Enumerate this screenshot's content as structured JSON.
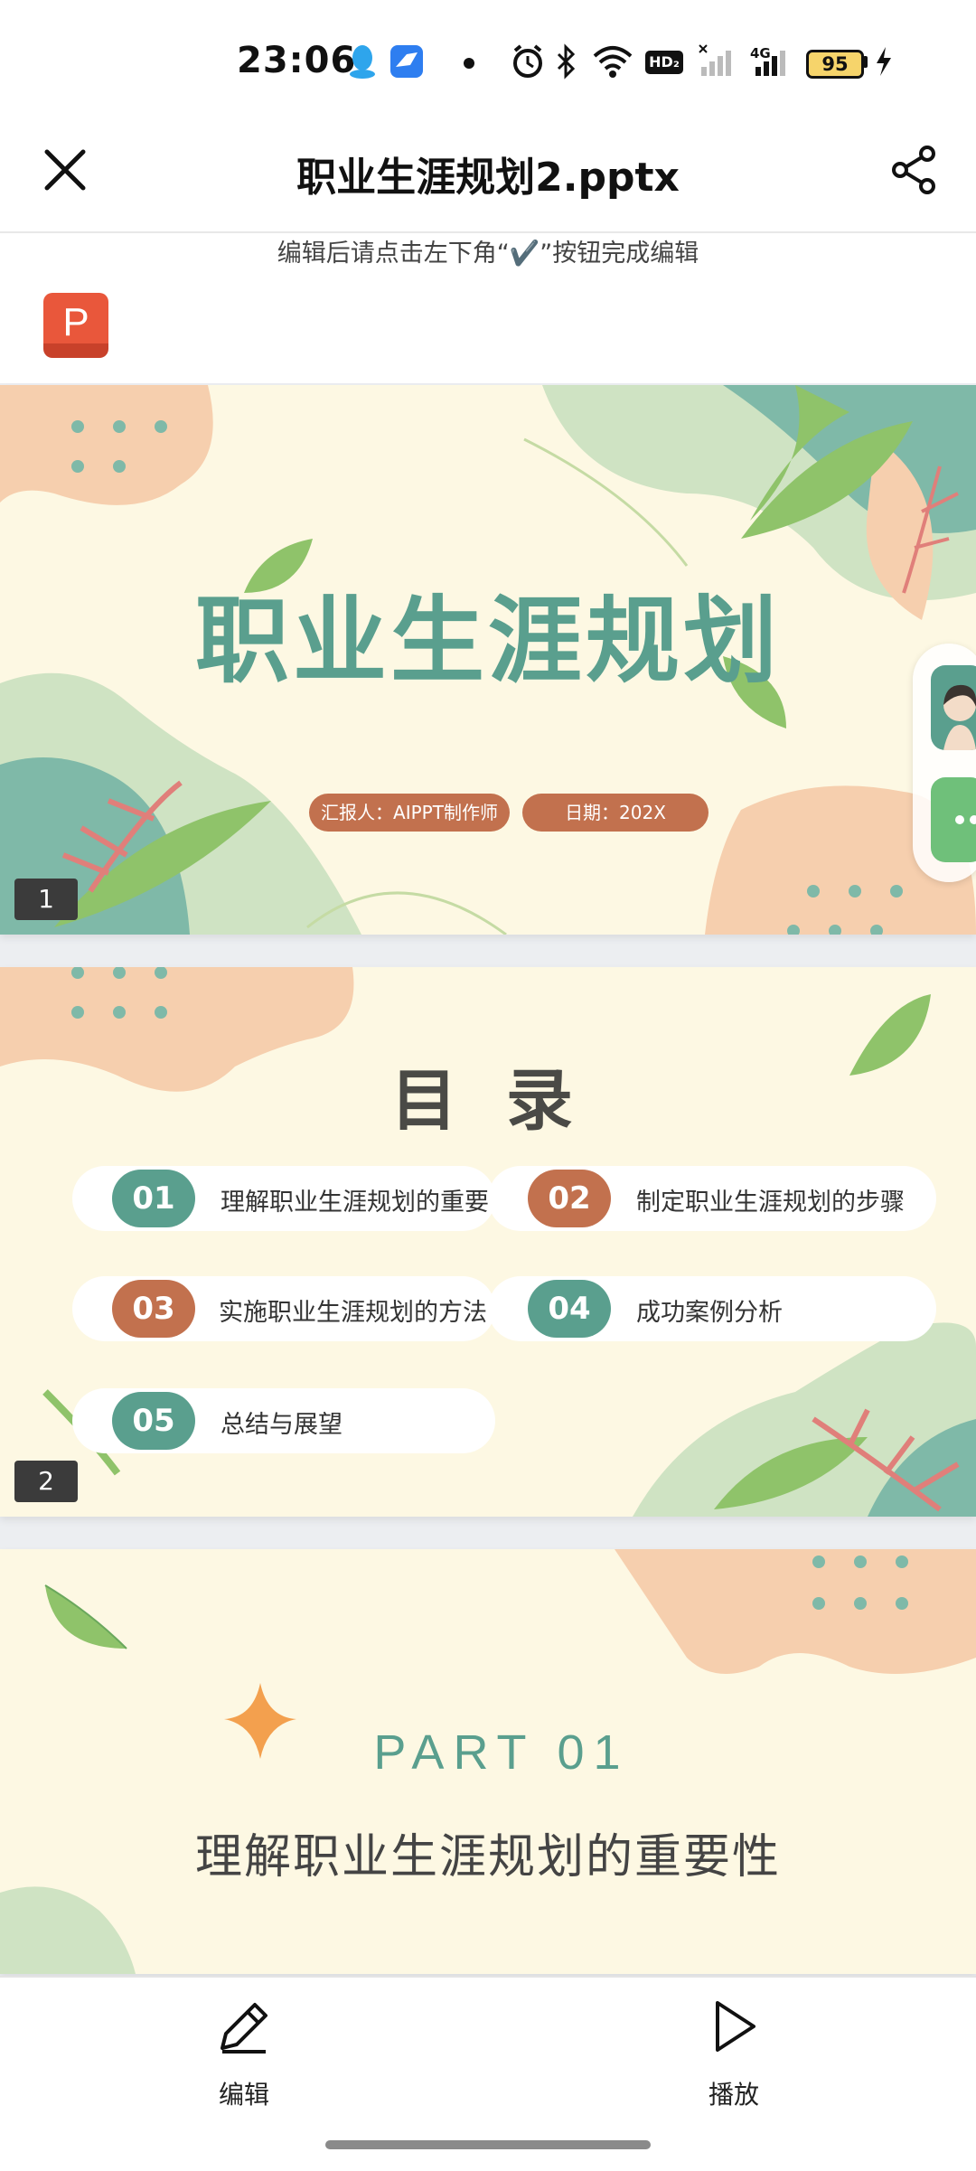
{
  "status_bar": {
    "time": "23:06",
    "network_badge": "HD₂",
    "cell_label": "4G",
    "battery": "95",
    "icons": [
      "qq-icon",
      "bird-app-icon",
      "dot-icon",
      "alarm-icon",
      "bluetooth-icon",
      "wifi-icon",
      "hd-icon",
      "signal-icon",
      "cell-4g-icon",
      "battery-icon",
      "charging-icon"
    ]
  },
  "toolbar": {
    "title": "职业生涯规划2.pptx",
    "close_icon": "close-icon",
    "share_icon": "share-icon"
  },
  "hint": "编辑后请点击左下角“✔️”按钮完成编辑",
  "file_badge": "P",
  "slides": [
    {
      "number": "1",
      "title": "职业生涯规划",
      "reporter": "汇报人：AIPPT制作师",
      "date": "日期：202X"
    },
    {
      "number": "2",
      "title": "目 录",
      "items": [
        {
          "num": "01",
          "label": "理解职业生涯规划的重要性"
        },
        {
          "num": "02",
          "label": "制定职业生涯规划的步骤"
        },
        {
          "num": "03",
          "label": "实施职业生涯规划的方法"
        },
        {
          "num": "04",
          "label": "成功案例分析"
        },
        {
          "num": "05",
          "label": "总结与展望"
        }
      ]
    },
    {
      "part": "PART 01",
      "heading": "理解职业生涯规划的重要性"
    }
  ],
  "bottom_bar": {
    "edit_label": "编辑",
    "play_label": "播放"
  },
  "colors": {
    "teal": "#5a9f8e",
    "rust": "#c2714e",
    "cream": "#fdf8e3",
    "peach": "#f6cfae",
    "leaf_green": "#8fc36a"
  }
}
